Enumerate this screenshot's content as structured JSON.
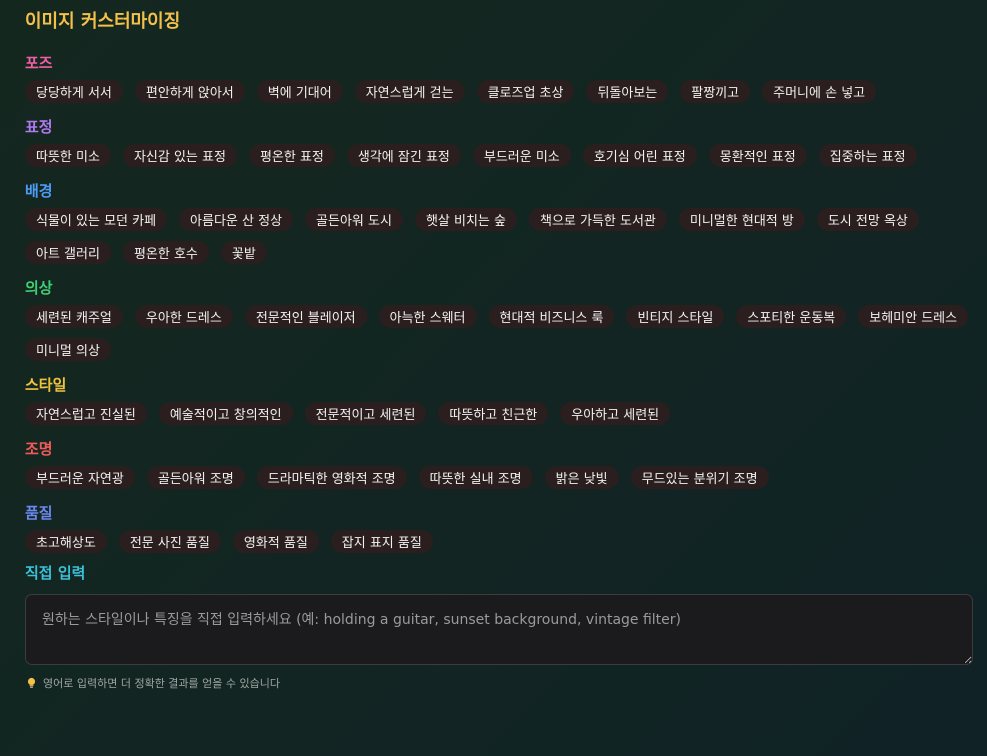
{
  "page": {
    "title": "이미지 커스터마이징"
  },
  "colors": {
    "title": "#f3c04a",
    "pose": "#f25fa4",
    "expression": "#b17af1",
    "background": "#4e9cf5",
    "outfit": "#3fcf74",
    "style": "#f0c33c",
    "lighting": "#f25a5a",
    "quality": "#6b8af0",
    "custom": "#3bc1d8",
    "chip_bg": "#2b1e1e"
  },
  "sections": {
    "pose": {
      "title": "포즈",
      "items": [
        "당당하게 서서",
        "편안하게 앉아서",
        "벽에 기대어",
        "자연스럽게 걷는",
        "클로즈업 초상",
        "뒤돌아보는",
        "팔짱끼고",
        "주머니에 손 넣고"
      ]
    },
    "expression": {
      "title": "표정",
      "items": [
        "따뜻한 미소",
        "자신감 있는 표정",
        "평온한 표정",
        "생각에 잠긴 표정",
        "부드러운 미소",
        "호기심 어린 표정",
        "몽환적인 표정",
        "집중하는 표정"
      ]
    },
    "background": {
      "title": "배경",
      "items": [
        "식물이 있는 모던 카페",
        "아름다운 산 정상",
        "골든아워 도시",
        "햇살 비치는 숲",
        "책으로 가득한 도서관",
        "미니멀한 현대적 방",
        "도시 전망 옥상",
        "아트 갤러리",
        "평온한 호수",
        "꽃밭"
      ]
    },
    "outfit": {
      "title": "의상",
      "items": [
        "세련된 캐주얼",
        "우아한 드레스",
        "전문적인 블레이저",
        "아늑한 스웨터",
        "현대적 비즈니스 룩",
        "빈티지 스타일",
        "스포티한 운동복",
        "보헤미안 드레스",
        "미니멀 의상"
      ]
    },
    "style": {
      "title": "스타일",
      "items": [
        "자연스럽고 진실된",
        "예술적이고 창의적인",
        "전문적이고 세련된",
        "따뜻하고 친근한",
        "우아하고 세련된"
      ]
    },
    "lighting": {
      "title": "조명",
      "items": [
        "부드러운 자연광",
        "골든아워 조명",
        "드라마틱한 영화적 조명",
        "따뜻한 실내 조명",
        "밝은 낮빛",
        "무드있는 분위기 조명"
      ]
    },
    "quality": {
      "title": "품질",
      "items": [
        "초고해상도",
        "전문 사진 품질",
        "영화적 품질",
        "잡지 표지 품질"
      ]
    }
  },
  "custom_input": {
    "title": "직접 입력",
    "value": "",
    "placeholder": "원하는 스타일이나 특징을 직접 입력하세요 (예: holding a guitar, sunset background, vintage filter)",
    "hint_icon": "lightbulb-icon",
    "hint": "영어로 입력하면 더 정확한 결과를 얻을 수 있습니다"
  }
}
